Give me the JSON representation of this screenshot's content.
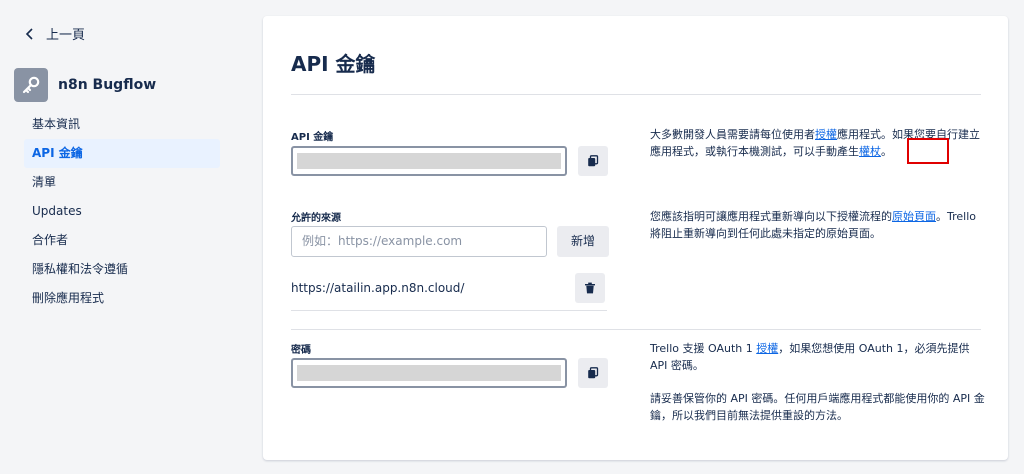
{
  "sidebar": {
    "back_label": "上一頁",
    "app_name": "n8n Bugflow",
    "items": [
      {
        "label": "基本資訊"
      },
      {
        "label": "API 金鑰"
      },
      {
        "label": "清單"
      },
      {
        "label": "Updates"
      },
      {
        "label": "合作者"
      },
      {
        "label": "隱私權和法令遵循"
      },
      {
        "label": "刪除應用程式"
      }
    ],
    "active_index": 1
  },
  "main": {
    "title": "API 金鑰",
    "api_key": {
      "label": "API 金鑰",
      "value": ""
    },
    "api_desc": {
      "p1_before": "大多數開發人員需要請每位使用者",
      "p1_link1": "授權",
      "p1_mid": "應用程式。如果您要自行建立應用程式，或執行本機測試，可以手動產生",
      "p1_link2": "權杖",
      "p1_after": "。"
    },
    "origins": {
      "label": "允許的來源",
      "placeholder": "例如：https://example.com",
      "add_label": "新增",
      "items": [
        "https://atailin.app.n8n.cloud/"
      ]
    },
    "origins_desc": {
      "p1_before": "您應該指明可讓應用程式重新導向以下授權流程的",
      "p1_link": "原始頁面",
      "p1_after": "。Trello 將阻止重新導向到任何此處未指定的原始頁面。"
    },
    "secret": {
      "label": "密碼",
      "value": ""
    },
    "secret_desc": {
      "p1_before": "Trello 支援 OAuth 1 ",
      "p1_link": "授權",
      "p1_after": "，如果您想使用 OAuth 1，必須先提供 API 密碼。",
      "p2": "請妥善保管你的 API 密碼。任何用戶端應用程式都能使用你的 API 金鑰，所以我們目前無法提供重設的方法。"
    }
  },
  "colors": {
    "accent": "#0c66e4",
    "highlight": "#e00000",
    "sidebar_active_bg": "#e9f2ff"
  },
  "icons": {
    "back": "chevron-left-icon",
    "app": "key-icon",
    "copy": "copy-icon",
    "delete": "trash-icon"
  }
}
